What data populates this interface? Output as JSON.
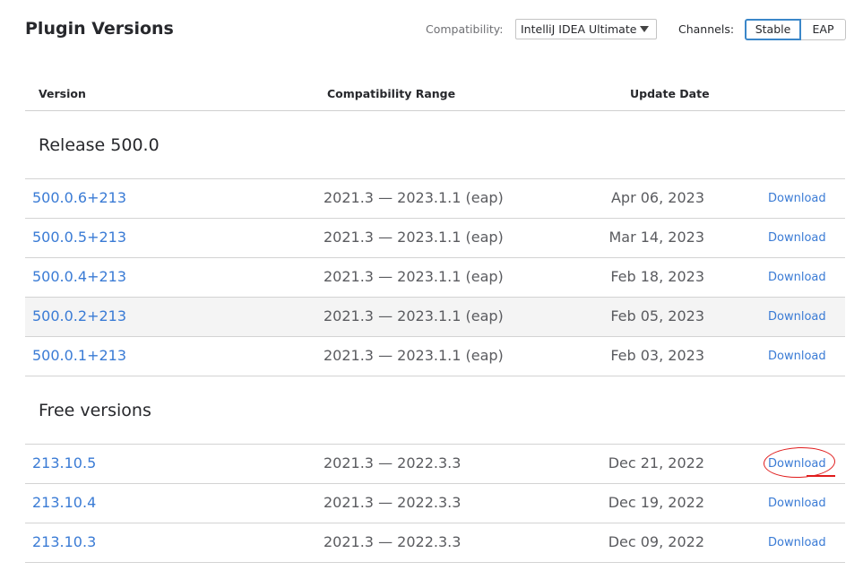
{
  "header": {
    "title": "Plugin Versions",
    "compatibility_label": "Compatibility:",
    "compatibility_value": "IntelliJ IDEA Ultimate",
    "channels_label": "Channels:",
    "channels": [
      "Stable",
      "EAP"
    ]
  },
  "table": {
    "columns": [
      "Version",
      "Compatibility Range",
      "Update Date"
    ],
    "sections": [
      {
        "title": "Release 500.0",
        "rows": [
          {
            "version": "500.0.6+213",
            "range": "2021.3 — 2023.1.1 (eap)",
            "date": "Apr 06, 2023",
            "action": "Download"
          },
          {
            "version": "500.0.5+213",
            "range": "2021.3 — 2023.1.1 (eap)",
            "date": "Mar 14, 2023",
            "action": "Download"
          },
          {
            "version": "500.0.4+213",
            "range": "2021.3 — 2023.1.1 (eap)",
            "date": "Feb 18, 2023",
            "action": "Download"
          },
          {
            "version": "500.0.2+213",
            "range": "2021.3 — 2023.1.1 (eap)",
            "date": "Feb 05, 2023",
            "action": "Download"
          },
          {
            "version": "500.0.1+213",
            "range": "2021.3 — 2023.1.1 (eap)",
            "date": "Feb 03, 2023",
            "action": "Download"
          }
        ]
      },
      {
        "title": "Free versions",
        "rows": [
          {
            "version": "213.10.5",
            "range": "2021.3 — 2022.3.3",
            "date": "Dec 21, 2022",
            "action": "Download"
          },
          {
            "version": "213.10.4",
            "range": "2021.3 — 2022.3.3",
            "date": "Dec 19, 2022",
            "action": "Download"
          },
          {
            "version": "213.10.3",
            "range": "2021.3 — 2022.3.3",
            "date": "Dec 09, 2022",
            "action": "Download"
          }
        ]
      }
    ]
  },
  "colors": {
    "link": "#3a7bd5",
    "selected_channel_border": "#3b87c9",
    "highlight_row": "#f4f4f4",
    "annotation": "#e01b1b"
  }
}
